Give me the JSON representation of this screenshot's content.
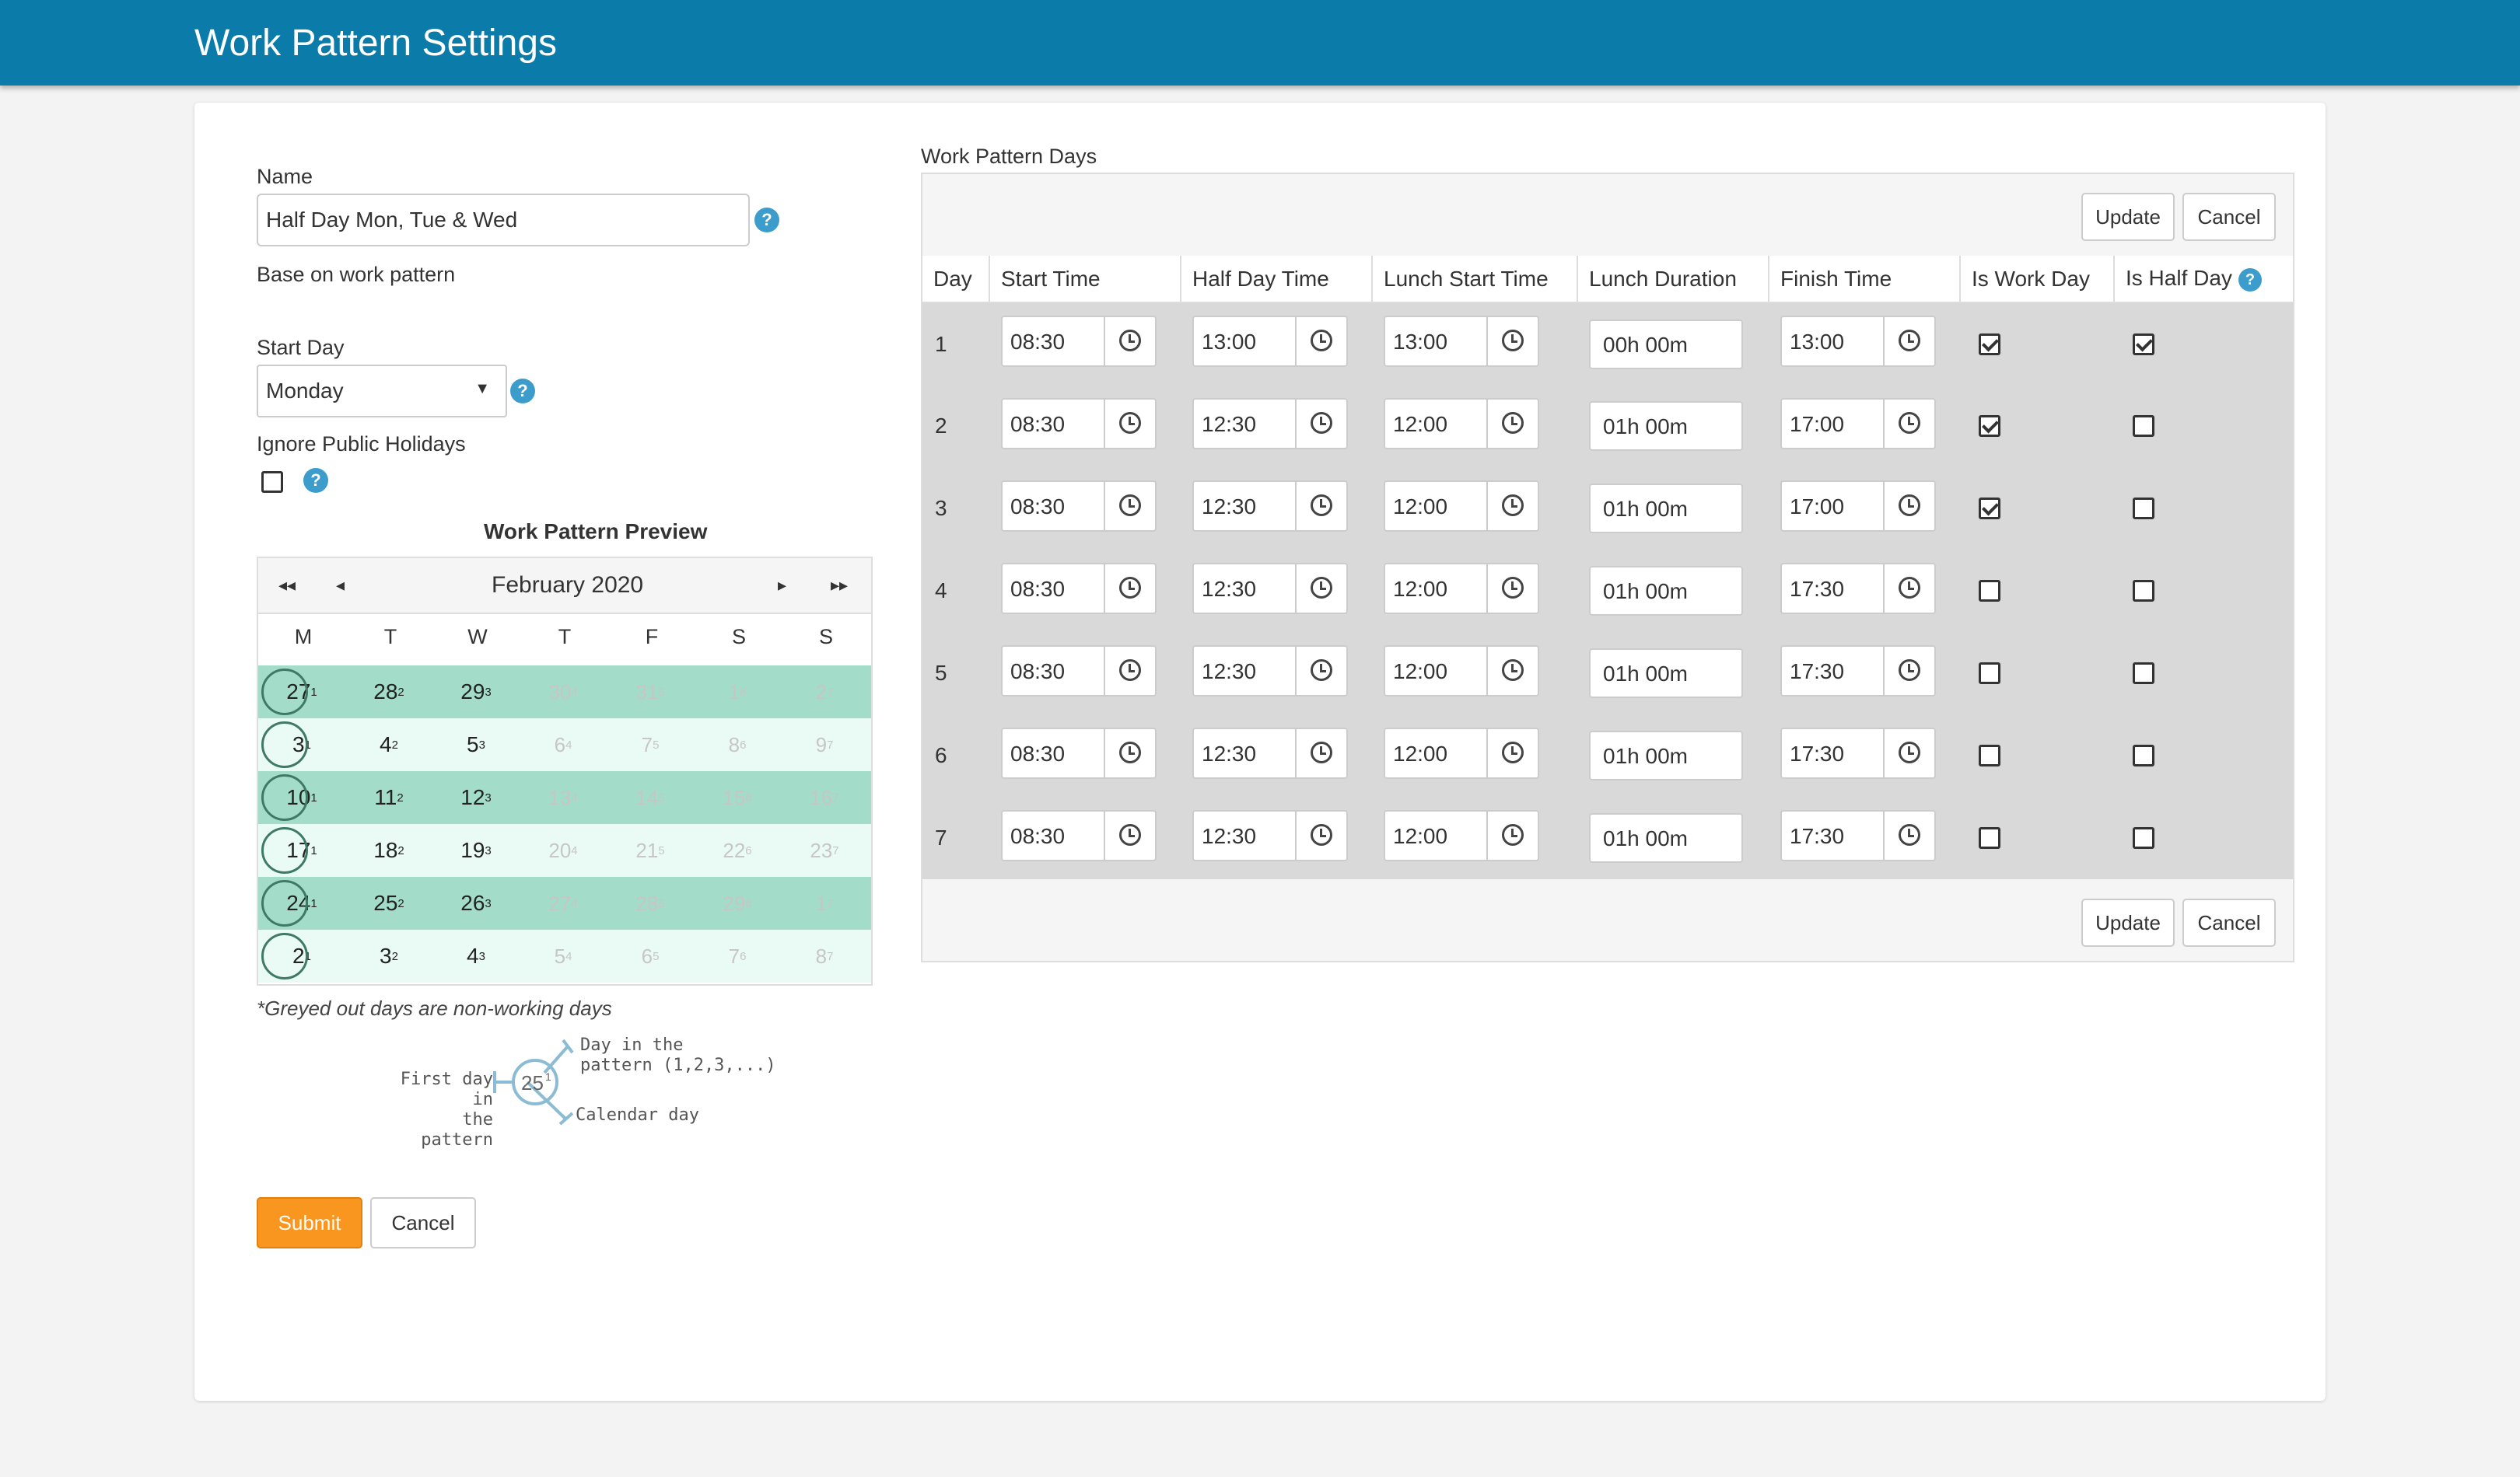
{
  "header": {
    "title": "Work Pattern Settings"
  },
  "form": {
    "name_label": "Name",
    "name_value": "Half Day Mon, Tue & Wed",
    "base_label": "Base on work pattern",
    "start_day_label": "Start Day",
    "start_day_value": "Monday",
    "ignore_holidays_label": "Ignore Public Holidays",
    "ignore_holidays_checked": false,
    "help_glyph": "?"
  },
  "preview": {
    "title": "Work Pattern Preview",
    "month": "February 2020",
    "nav_first": "◂◂",
    "nav_prev": "◂",
    "nav_next": "▸",
    "nav_last": "▸▸",
    "weekdays": [
      "M",
      "T",
      "W",
      "T",
      "F",
      "S",
      "S"
    ],
    "weeks": [
      [
        {
          "d": "27",
          "p": "1",
          "off": false
        },
        {
          "d": "28",
          "p": "2",
          "off": false
        },
        {
          "d": "29",
          "p": "3",
          "off": false
        },
        {
          "d": "30",
          "p": "4",
          "off": true
        },
        {
          "d": "31",
          "p": "5",
          "off": true
        },
        {
          "d": "1",
          "p": "6",
          "off": true
        },
        {
          "d": "2",
          "p": "7",
          "off": true
        }
      ],
      [
        {
          "d": "3",
          "p": "1",
          "off": false
        },
        {
          "d": "4",
          "p": "2",
          "off": false
        },
        {
          "d": "5",
          "p": "3",
          "off": false
        },
        {
          "d": "6",
          "p": "4",
          "off": true
        },
        {
          "d": "7",
          "p": "5",
          "off": true
        },
        {
          "d": "8",
          "p": "6",
          "off": true
        },
        {
          "d": "9",
          "p": "7",
          "off": true
        }
      ],
      [
        {
          "d": "10",
          "p": "1",
          "off": false
        },
        {
          "d": "11",
          "p": "2",
          "off": false
        },
        {
          "d": "12",
          "p": "3",
          "off": false
        },
        {
          "d": "13",
          "p": "4",
          "off": true
        },
        {
          "d": "14",
          "p": "5",
          "off": true
        },
        {
          "d": "15",
          "p": "6",
          "off": true
        },
        {
          "d": "16",
          "p": "7",
          "off": true
        }
      ],
      [
        {
          "d": "17",
          "p": "1",
          "off": false
        },
        {
          "d": "18",
          "p": "2",
          "off": false
        },
        {
          "d": "19",
          "p": "3",
          "off": false
        },
        {
          "d": "20",
          "p": "4",
          "off": true
        },
        {
          "d": "21",
          "p": "5",
          "off": true
        },
        {
          "d": "22",
          "p": "6",
          "off": true
        },
        {
          "d": "23",
          "p": "7",
          "off": true
        }
      ],
      [
        {
          "d": "24",
          "p": "1",
          "off": false
        },
        {
          "d": "25",
          "p": "2",
          "off": false
        },
        {
          "d": "26",
          "p": "3",
          "off": false
        },
        {
          "d": "27",
          "p": "4",
          "off": true
        },
        {
          "d": "28",
          "p": "5",
          "off": true
        },
        {
          "d": "29",
          "p": "6",
          "off": true
        },
        {
          "d": "1",
          "p": "7",
          "off": true
        }
      ],
      [
        {
          "d": "2",
          "p": "1",
          "off": false
        },
        {
          "d": "3",
          "p": "2",
          "off": false
        },
        {
          "d": "4",
          "p": "3",
          "off": false
        },
        {
          "d": "5",
          "p": "4",
          "off": true
        },
        {
          "d": "6",
          "p": "5",
          "off": true
        },
        {
          "d": "7",
          "p": "6",
          "off": true
        },
        {
          "d": "8",
          "p": "7",
          "off": true
        }
      ]
    ],
    "note": "*Greyed out days are non-working days",
    "legend": {
      "first_day_line1": "First day in",
      "first_day_line2": "the pattern",
      "pattern_day_line1": "Day in the",
      "pattern_day_line2": "pattern (1,2,3,...)",
      "calendar_day": "Calendar day",
      "sample_day": "25",
      "sample_pattern": "1"
    }
  },
  "actions": {
    "submit": "Submit",
    "cancel": "Cancel"
  },
  "work_pattern_days": {
    "title": "Work Pattern Days",
    "update_label": "Update",
    "cancel_label": "Cancel",
    "columns": [
      "Day",
      "Start Time",
      "Half Day Time",
      "Lunch Start Time",
      "Lunch Duration",
      "Finish Time",
      "Is Work Day",
      "Is Half Day"
    ],
    "rows": [
      {
        "day": "1",
        "start": "08:30",
        "half": "13:00",
        "lunch_start": "13:00",
        "duration": "00h 00m",
        "finish": "13:00",
        "work_day": true,
        "half_day": true
      },
      {
        "day": "2",
        "start": "08:30",
        "half": "12:30",
        "lunch_start": "12:00",
        "duration": "01h 00m",
        "finish": "17:00",
        "work_day": true,
        "half_day": false
      },
      {
        "day": "3",
        "start": "08:30",
        "half": "12:30",
        "lunch_start": "12:00",
        "duration": "01h 00m",
        "finish": "17:00",
        "work_day": true,
        "half_day": false
      },
      {
        "day": "4",
        "start": "08:30",
        "half": "12:30",
        "lunch_start": "12:00",
        "duration": "01h 00m",
        "finish": "17:30",
        "work_day": false,
        "half_day": false
      },
      {
        "day": "5",
        "start": "08:30",
        "half": "12:30",
        "lunch_start": "12:00",
        "duration": "01h 00m",
        "finish": "17:30",
        "work_day": false,
        "half_day": false
      },
      {
        "day": "6",
        "start": "08:30",
        "half": "12:30",
        "lunch_start": "12:00",
        "duration": "01h 00m",
        "finish": "17:30",
        "work_day": false,
        "half_day": false
      },
      {
        "day": "7",
        "start": "08:30",
        "half": "12:30",
        "lunch_start": "12:00",
        "duration": "01h 00m",
        "finish": "17:30",
        "work_day": false,
        "half_day": false
      }
    ]
  },
  "colors": {
    "header_bg": "#0b7ca9",
    "accent_orange": "#f8961f",
    "help_blue": "#3c9ccc",
    "working_week_dark": "#a3ddc9",
    "working_week_light": "#eafaf4"
  }
}
